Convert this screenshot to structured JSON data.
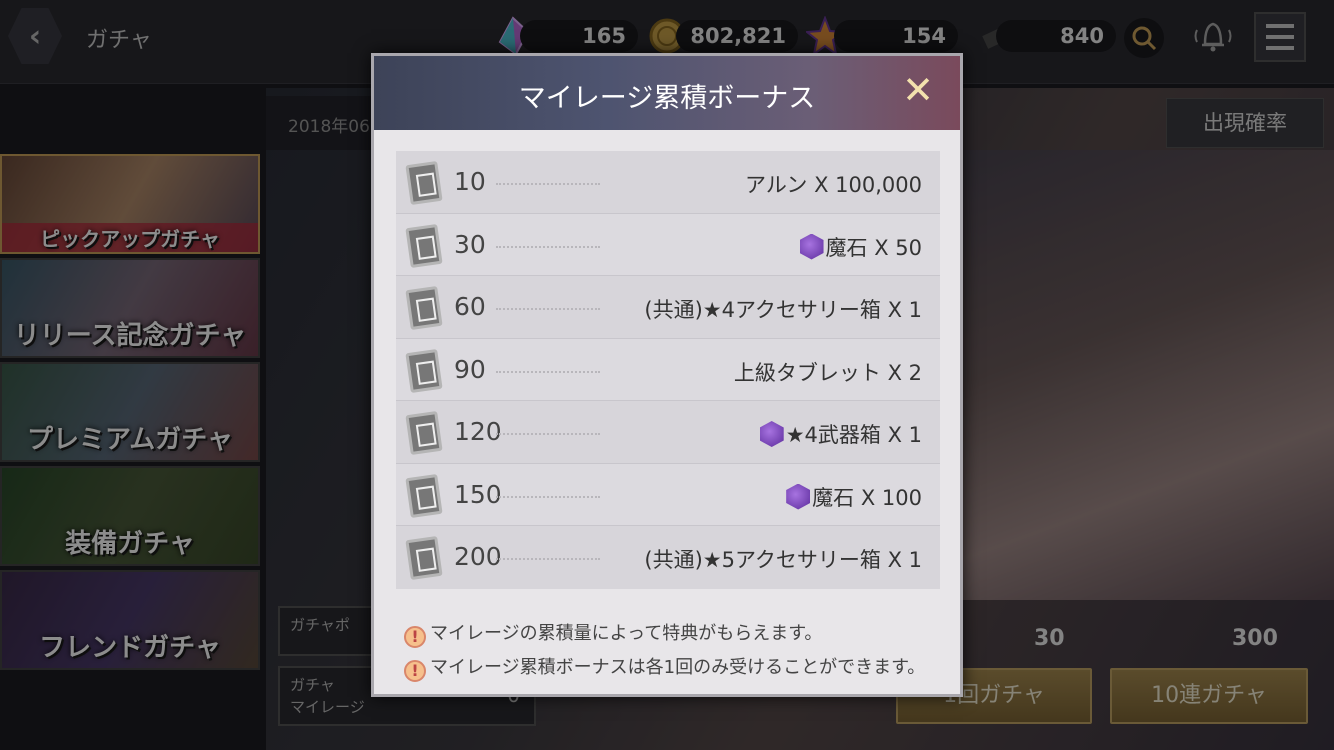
{
  "header": {
    "title": "ガチャ"
  },
  "currencies": [
    {
      "name": "crystal",
      "value": "165"
    },
    {
      "name": "gold",
      "value": "802,821"
    },
    {
      "name": "star-token",
      "value": "154"
    },
    {
      "name": "ticket",
      "value": "840"
    }
  ],
  "background": {
    "date_text": "2018年06",
    "odds_button": "出現確率",
    "banners": [
      "ピックアップガチャ",
      "リリース記念ガチャ",
      "プレミアムガチャ",
      "装備ガチャ",
      "フレンドガチャ"
    ],
    "mileage_label_1": "ガチャ",
    "mileage_label_2": "マイレージ",
    "gacha_point_label": "ガチャポ",
    "mileage_value": "0",
    "cost_single": "30",
    "cost_ten": "300",
    "pull_single": "1回ガチャ",
    "pull_ten": "10連ガチャ"
  },
  "modal": {
    "title": "マイレージ累積ボーナス",
    "rewards": [
      {
        "milestone": "10",
        "item": "アルン X 100,000",
        "gem_icon": false
      },
      {
        "milestone": "30",
        "item": "魔石 X 50",
        "gem_icon": true
      },
      {
        "milestone": "60",
        "item": "(共通)★4アクセサリー箱 X 1",
        "gem_icon": false
      },
      {
        "milestone": "90",
        "item": "上級タブレット X 2",
        "gem_icon": false
      },
      {
        "milestone": "120",
        "item": "★4武器箱 X 1",
        "gem_icon": true
      },
      {
        "milestone": "150",
        "item": "魔石 X 100",
        "gem_icon": true
      },
      {
        "milestone": "200",
        "item": "(共通)★5アクセサリー箱 X 1",
        "gem_icon": false
      }
    ],
    "notes": [
      "マイレージの累積量によって特典がもらえます。",
      "マイレージ累積ボーナスは各1回のみ受けることができます。"
    ]
  }
}
